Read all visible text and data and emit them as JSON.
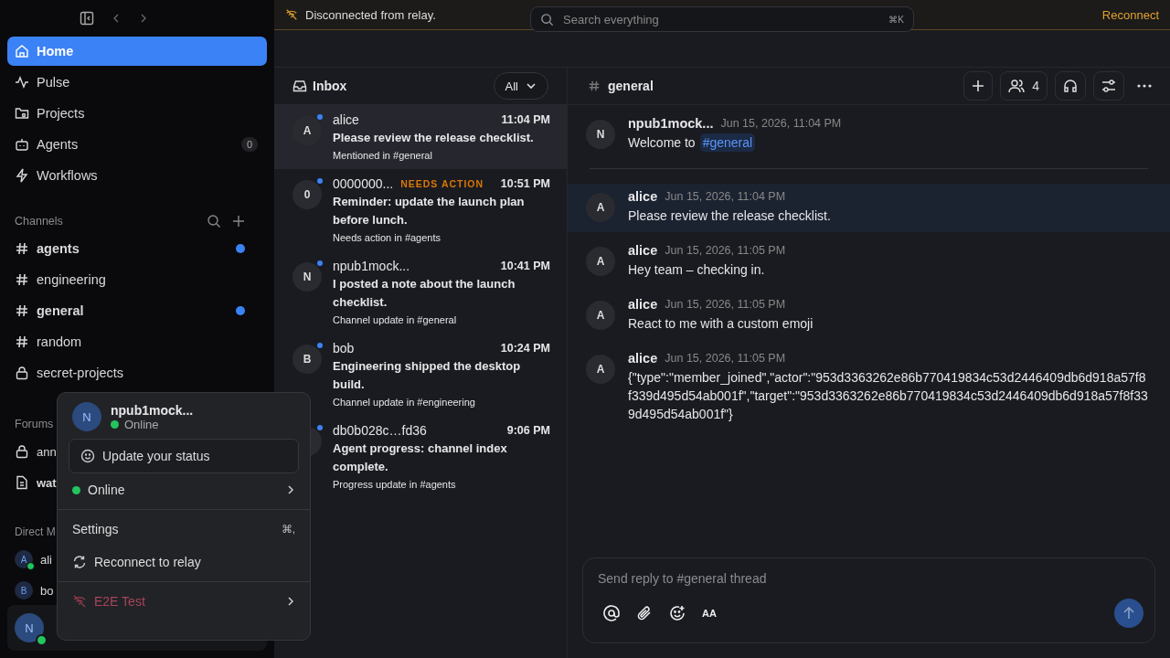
{
  "sidebar": {
    "nav": [
      {
        "label": "Home",
        "selected": true
      },
      {
        "label": "Pulse",
        "selected": false
      },
      {
        "label": "Projects",
        "selected": false
      },
      {
        "label": "Agents",
        "selected": false,
        "badge": "0"
      },
      {
        "label": "Workflows",
        "selected": false
      }
    ],
    "channels_heading": "Channels",
    "channels": [
      {
        "name": "agents",
        "kind": "public",
        "unread": true
      },
      {
        "name": "engineering",
        "kind": "public",
        "unread": false
      },
      {
        "name": "general",
        "kind": "public",
        "unread": true
      },
      {
        "name": "random",
        "kind": "public",
        "unread": false
      },
      {
        "name": "secret-projects",
        "kind": "private",
        "unread": false
      }
    ],
    "forums_heading": "Forums",
    "forums": [
      {
        "name": "ann",
        "kind": "private",
        "unread": false
      },
      {
        "name": "wat",
        "kind": "document",
        "unread": true
      }
    ],
    "dms_heading": "Direct M",
    "dms": [
      {
        "name": "ali",
        "avatar": "A",
        "online": true
      },
      {
        "name": "bo",
        "avatar": "B",
        "online": false
      }
    ],
    "user": {
      "avatar": "N",
      "online": true
    }
  },
  "banner": {
    "text": "Disconnected from relay.",
    "action": "Reconnect"
  },
  "search": {
    "placeholder": "Search everything",
    "shortcut": "⌘K"
  },
  "inbox": {
    "title": "Inbox",
    "filter": "All",
    "items": [
      {
        "avatar": "A",
        "unread": true,
        "name": "alice",
        "time": "11:04 PM",
        "message": "Please review the release checklist.",
        "context": "Mentioned in #general",
        "selected": true
      },
      {
        "avatar": "0",
        "unread": true,
        "name": "0000000...",
        "tag": "NEEDS ACTION",
        "time": "10:51 PM",
        "message": "Reminder: update the launch plan before lunch.",
        "context": "Needs action in #agents",
        "selected": false
      },
      {
        "avatar": "N",
        "unread": true,
        "name": "npub1mock...",
        "time": "10:41 PM",
        "message": "I posted a note about the launch checklist.",
        "context": "Channel update in #general",
        "selected": false
      },
      {
        "avatar": "B",
        "unread": true,
        "name": "bob",
        "time": "10:24 PM",
        "message": "Engineering shipped the desktop build.",
        "context": "Channel update in #engineering",
        "selected": false
      },
      {
        "unread": true,
        "name": "db0b028c…fd36",
        "time": "9:06 PM",
        "message": "Agent progress: channel index complete.",
        "context": "Progress update in #agents",
        "selected": false
      }
    ]
  },
  "channel": {
    "name": "general",
    "members": "4",
    "messages": [
      {
        "avatar": "N",
        "author": "npub1mock...",
        "time": "Jun 15, 2026, 11:04 PM",
        "text": "Welcome to",
        "link": "#general",
        "selected": false
      },
      {
        "avatar": "A",
        "author": "alice",
        "time": "Jun 15, 2026, 11:04 PM",
        "text": "Please review the release checklist.",
        "selected": true
      },
      {
        "avatar": "A",
        "author": "alice",
        "time": "Jun 15, 2026, 11:05 PM",
        "text": "Hey team – checking in.",
        "selected": false
      },
      {
        "avatar": "A",
        "author": "alice",
        "time": "Jun 15, 2026, 11:05 PM",
        "text": "React to me with a custom emoji",
        "selected": false
      },
      {
        "avatar": "A",
        "author": "alice",
        "time": "Jun 15, 2026, 11:05 PM",
        "text": "{\"type\":\"member_joined\",\"actor\":\"953d3363262e86b770419834c53d2446409db6d918a57f8f339d495d54ab001f\",\"target\":\"953d3363262e86b770419834c53d2446409db6d918a57f8f339d495d54ab001f\"}",
        "selected": false
      }
    ],
    "composer": {
      "placeholder": "Send reply to #general thread",
      "format_label": "AA"
    }
  },
  "menu": {
    "name": "npub1mock...",
    "avatar": "N",
    "status": "Online",
    "status_button": "Update your status",
    "presence": "Online",
    "settings": "Settings",
    "settings_shortcut": "⌘,",
    "reconnect": "Reconnect to relay",
    "workspace": "E2E Test"
  }
}
